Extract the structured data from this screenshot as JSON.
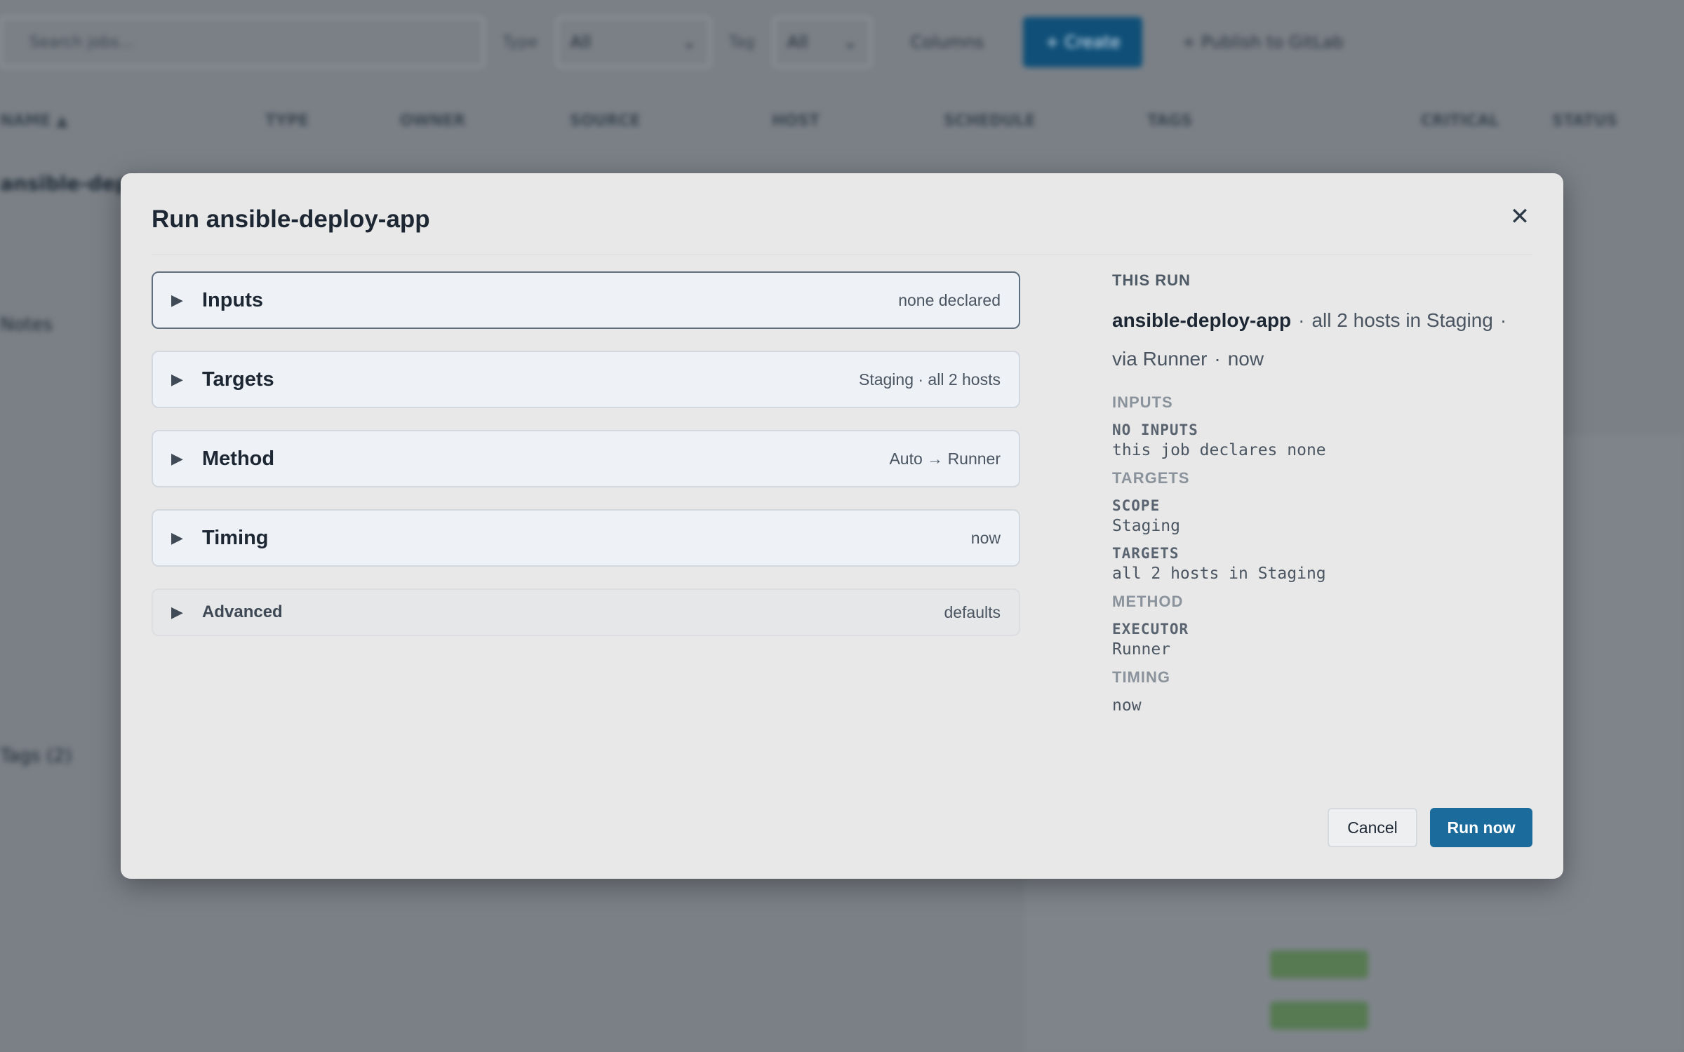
{
  "background": {
    "search_placeholder": "Search jobs...",
    "type_label": "Type",
    "type_value": "All",
    "tag_label": "Tag",
    "tag_value": "All",
    "filter_btn": "Columns",
    "create_btn": "+ Create",
    "publish_btn": "+ Publish to GitLab",
    "columns": [
      "NAME ▲",
      "TYPE",
      "OWNER",
      "SOURCE",
      "HOST",
      "SCHEDULE",
      "TAGS",
      "CRITICAL",
      "STATUS"
    ],
    "row_name": "ansible-deploy-app",
    "side_notes": "Notes",
    "side_tags": "Tags (2)"
  },
  "modal": {
    "title": "Run ansible-deploy-app",
    "close_icon": "close-icon",
    "sections": [
      {
        "name": "Inputs",
        "summary": "none declared"
      },
      {
        "name": "Targets",
        "summary": "Staging · all 2 hosts"
      },
      {
        "name": "Method",
        "summary": "Auto → Runner"
      },
      {
        "name": "Timing",
        "summary": "now"
      },
      {
        "name": "Advanced",
        "summary": "defaults"
      }
    ],
    "summary_panel": {
      "heading": "THIS RUN",
      "job": "ansible-deploy-app",
      "scope_text": "all 2 hosts in Staging",
      "via_text": "via Runner",
      "when_text": "now",
      "groups": {
        "inputs": {
          "title": "INPUTS",
          "key": "NO INPUTS",
          "value": "this job declares none"
        },
        "targets": {
          "title": "TARGETS",
          "scope_key": "SCOPE",
          "scope_value": "Staging",
          "targets_key": "TARGETS",
          "targets_value": "all 2 hosts in Staging"
        },
        "method": {
          "title": "METHOD",
          "key": "EXECUTOR",
          "value": "Runner"
        },
        "timing": {
          "title": "TIMING",
          "value": "now"
        }
      }
    },
    "buttons": {
      "cancel": "Cancel",
      "run": "Run now"
    }
  },
  "colors": {
    "primary": "#1b6b9c",
    "overlay": "#7b8087",
    "modal_bg": "#e8e8e8"
  }
}
